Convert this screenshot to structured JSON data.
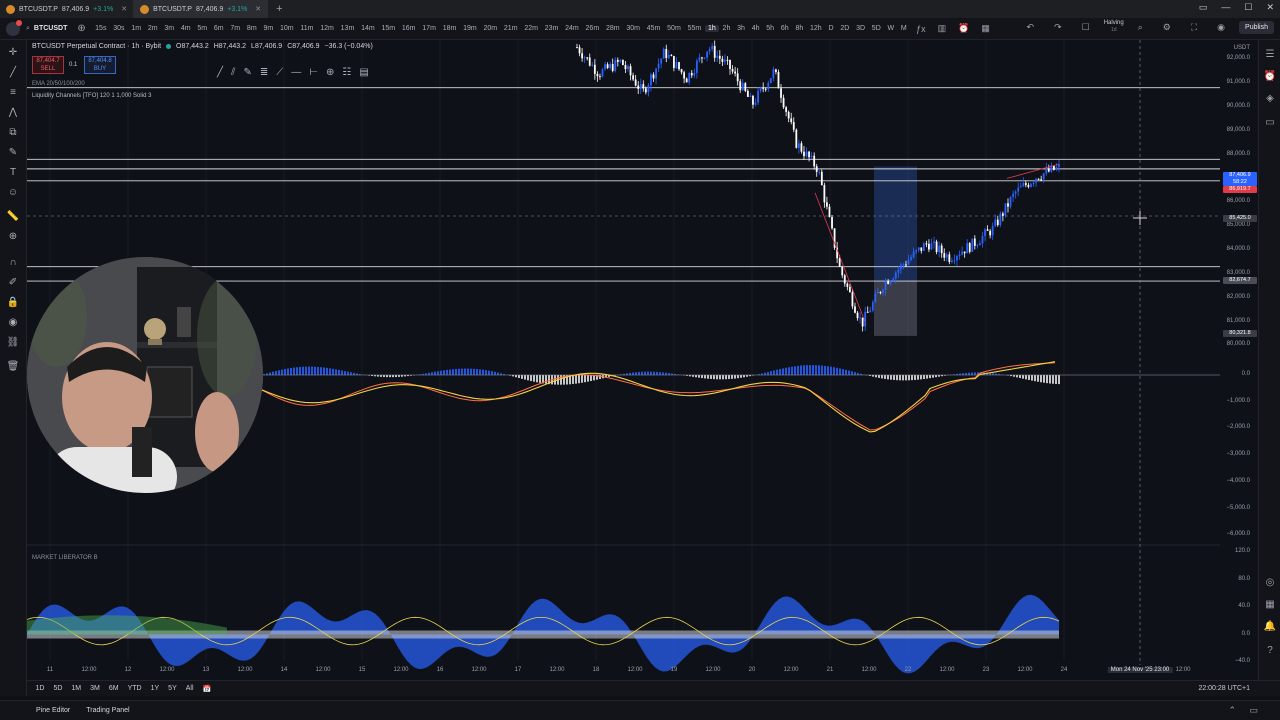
{
  "browser": {
    "tabs": [
      {
        "label": "BTCUSDT.P",
        "price": "87,406.9",
        "change": "+3.1%",
        "active": false
      },
      {
        "label": "BTCUSDT.P",
        "price": "87,406.9",
        "change": "+3.1%",
        "active": true
      }
    ]
  },
  "toolbar": {
    "symbol": "BTCUSDT",
    "timeframes": [
      "15s",
      "30s",
      "1m",
      "2m",
      "3m",
      "4m",
      "5m",
      "6m",
      "7m",
      "8m",
      "9m",
      "10m",
      "11m",
      "12m",
      "13m",
      "14m",
      "15m",
      "16m",
      "17m",
      "18m",
      "19m",
      "20m",
      "21m",
      "22m",
      "23m",
      "24m",
      "26m",
      "28m",
      "30m",
      "45m",
      "50m",
      "55m",
      "1h",
      "2h",
      "3h",
      "4h",
      "5h",
      "6h",
      "8h",
      "12h",
      "D",
      "2D",
      "3D",
      "5D",
      "W",
      "M"
    ],
    "active_timeframe": "1h",
    "halving_label": "Halving",
    "halving_sub": "1d",
    "publish_label": "Publish"
  },
  "legend": {
    "title": "BTCUSDT Perpetual Contract · 1h · Bybit",
    "open": "O87,443.2",
    "high": "H87,443.2",
    "low": "L87,406.9",
    "close": "C87,406.9",
    "change": "−36.3 (−0.04%)",
    "sell_price": "87,404.7",
    "sell_label": "SELL",
    "spread": "0.1",
    "buy_price": "87,404.8",
    "buy_label": "BUY",
    "ema_label": "EMA 20/50/100/200",
    "liquidity_label": "Liquidity Channels [TFO] 120 1 1,000 Solid 3",
    "lower_indicator": "MARKET LIBERATOR B"
  },
  "price_axis": {
    "currency": "USDT",
    "ticks": [
      "92,000.0",
      "91,000.0",
      "90,000.0",
      "89,000.0",
      "88,000.0",
      "87,000.0",
      "86,000.0",
      "85,000.0",
      "84,000.0",
      "83,000.0",
      "82,000.0",
      "81,000.0",
      "80,000.0"
    ],
    "labels": {
      "last": "87,406.9",
      "last_sub": "58:22",
      "level_red": "86,919.7",
      "crosshair": "85,425.0",
      "level_gray": "82,674.7",
      "level_low": "80,321.8"
    }
  },
  "macd_axis": [
    "0.0",
    "−1,000.0",
    "−2,000.0",
    "−3,000.0",
    "−4,000.0",
    "−5,000.0",
    "−6,000.0"
  ],
  "osc_axis": [
    "120.0",
    "80.0",
    "40.0",
    "0.0",
    "−40.0"
  ],
  "time_axis": {
    "labels": [
      "11",
      "12:00",
      "12",
      "12:00",
      "13",
      "12:00",
      "14",
      "12:00",
      "15",
      "12:00",
      "16",
      "12:00",
      "17",
      "12:00",
      "18",
      "12:00",
      "19",
      "12:00",
      "20",
      "12:00",
      "21",
      "12:00",
      "22",
      "12:00",
      "23",
      "12:00",
      "24"
    ],
    "crosshair": "Mon 24 Nov '25  23:00",
    "after": "12:00"
  },
  "chart_data": {
    "type": "line",
    "title": "BTCUSDT Perpetual Contract · 1h · Bybit",
    "xlabel": "",
    "ylabel": "",
    "x_range": [
      "11",
      "24"
    ],
    "ylim": [
      80000,
      92500
    ],
    "horizontal_levels": [
      90800,
      87800,
      87400,
      86900,
      83300,
      82700
    ],
    "series": [
      {
        "values": [
          92500,
          91400,
          91900,
          90600,
          92300,
          91200,
          92500,
          91600,
          90100,
          91500,
          88500,
          87400,
          83200,
          80900,
          82600,
          83500,
          84300,
          83700,
          84200,
          84900,
          86400,
          87100,
          87450
        ]
      }
    ]
  },
  "range_bar": {
    "ranges": [
      "1D",
      "5D",
      "1M",
      "3M",
      "6M",
      "YTD",
      "1Y",
      "5Y",
      "All"
    ],
    "clock": "22:00:28 UTC+1"
  },
  "bottom_panel": {
    "pine_editor": "Pine Editor",
    "trading_panel": "Trading Panel"
  },
  "colors": {
    "bull": "#2962ff",
    "bear": "#ffffff",
    "macd_line": "#f5d142",
    "signal_line": "#ff7043",
    "sell": "#ff5964",
    "buy": "#5c8ef5"
  }
}
